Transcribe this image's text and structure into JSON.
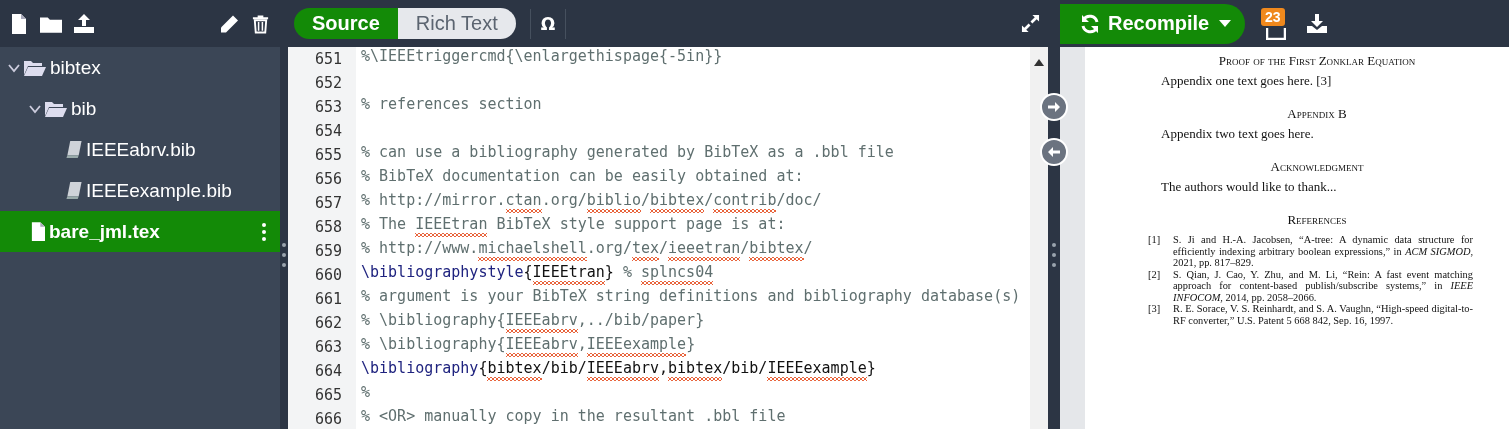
{
  "toolbar": {
    "editor_mode": [
      {
        "label": "Source",
        "selected": true
      },
      {
        "label": "Rich Text",
        "selected": false
      }
    ],
    "symbol_button": "Ω",
    "recompile": "Recompile",
    "log_badge": "23"
  },
  "file_tree": [
    {
      "name": "bibtex",
      "kind": "folder",
      "expanded": true,
      "selected": false,
      "children": [
        {
          "name": "bib",
          "kind": "folder",
          "expanded": true,
          "selected": false,
          "children": [
            {
              "name": "IEEEabrv.bib",
              "kind": "file",
              "selected": false
            },
            {
              "name": "IEEEexample.bib",
              "kind": "file",
              "selected": false
            }
          ]
        }
      ]
    },
    {
      "name": "bare_jml.tex",
      "kind": "file",
      "selected": true
    }
  ],
  "editor": {
    "lines": [
      {
        "number": "651",
        "segments": [
          {
            "text": "%\\IEEEtriggercmd{\\enlargethispage{-5in}}",
            "kind": "comment",
            "misspelled": false
          }
        ]
      },
      {
        "number": "652"
      },
      {
        "number": "653",
        "segments": [
          {
            "text": "% references section",
            "kind": "comment",
            "misspelled": false
          }
        ]
      },
      {
        "number": "654"
      },
      {
        "number": "655",
        "segments": [
          {
            "text": "% can use a bibliography generated by BibTeX as a .bbl file",
            "kind": "comment",
            "misspelled": false
          }
        ]
      },
      {
        "number": "656",
        "segments": [
          {
            "text": "% BibTeX documentation can be easily obtained at:",
            "kind": "comment",
            "misspelled": false
          }
        ]
      },
      {
        "number": "657",
        "segments": [
          {
            "text": "% http://mirror.",
            "kind": "comment",
            "misspelled": false
          },
          {
            "text": "ctan",
            "kind": "comment",
            "misspelled": true
          },
          {
            "text": ".org/",
            "kind": "comment",
            "misspelled": false
          },
          {
            "text": "biblio",
            "kind": "comment",
            "misspelled": true
          },
          {
            "text": "/",
            "kind": "comment",
            "misspelled": false
          },
          {
            "text": "bibtex",
            "kind": "comment",
            "misspelled": true
          },
          {
            "text": "/",
            "kind": "comment",
            "misspelled": false
          },
          {
            "text": "contrib",
            "kind": "comment",
            "misspelled": true
          },
          {
            "text": "/doc/",
            "kind": "comment",
            "misspelled": false
          }
        ]
      },
      {
        "number": "658",
        "segments": [
          {
            "text": "% The ",
            "kind": "comment",
            "misspelled": false
          },
          {
            "text": "IEEEtran",
            "kind": "comment",
            "misspelled": true
          },
          {
            "text": " BibTeX style support page is at:",
            "kind": "comment",
            "misspelled": false
          }
        ]
      },
      {
        "number": "659",
        "segments": [
          {
            "text": "% http://www.",
            "kind": "comment",
            "misspelled": false
          },
          {
            "text": "michaelshell",
            "kind": "comment",
            "misspelled": true
          },
          {
            "text": ".org/",
            "kind": "comment",
            "misspelled": false
          },
          {
            "text": "tex",
            "kind": "comment",
            "misspelled": true
          },
          {
            "text": "/",
            "kind": "comment",
            "misspelled": false
          },
          {
            "text": "ieeetran",
            "kind": "comment",
            "misspelled": true
          },
          {
            "text": "/",
            "kind": "comment",
            "misspelled": false
          },
          {
            "text": "bibtex",
            "kind": "comment",
            "misspelled": true
          },
          {
            "text": "/",
            "kind": "comment",
            "misspelled": false
          }
        ]
      },
      {
        "number": "660",
        "segments": [
          {
            "text": "\\bibliographystyle",
            "kind": "command",
            "misspelled": false
          },
          {
            "text": "{",
            "kind": "plain",
            "misspelled": false
          },
          {
            "text": "IEEEtran",
            "kind": "plain",
            "misspelled": true
          },
          {
            "text": "}",
            "kind": "plain",
            "misspelled": false
          },
          {
            "text": " % ",
            "kind": "comment",
            "misspelled": false
          },
          {
            "text": "splncs04",
            "kind": "comment",
            "misspelled": true
          }
        ]
      },
      {
        "number": "661",
        "segments": [
          {
            "text": "% argument is your BibTeX string definitions and bibliography database(s)",
            "kind": "comment",
            "misspelled": false
          }
        ]
      },
      {
        "number": "662",
        "segments": [
          {
            "text": "% \\bibliography{",
            "kind": "comment",
            "misspelled": false
          },
          {
            "text": "IEEEabrv",
            "kind": "comment",
            "misspelled": true
          },
          {
            "text": ",../bib/paper}",
            "kind": "comment",
            "misspelled": false
          }
        ]
      },
      {
        "number": "663",
        "segments": [
          {
            "text": "% \\bibliography{",
            "kind": "comment",
            "misspelled": false
          },
          {
            "text": "IEEEabrv",
            "kind": "comment",
            "misspelled": true
          },
          {
            "text": ",",
            "kind": "comment",
            "misspelled": false
          },
          {
            "text": "IEEEexample",
            "kind": "comment",
            "misspelled": true
          },
          {
            "text": "}",
            "kind": "comment",
            "misspelled": false
          }
        ]
      },
      {
        "number": "664",
        "segments": [
          {
            "text": "\\bibliography",
            "kind": "command",
            "misspelled": false
          },
          {
            "text": "{",
            "kind": "plain",
            "misspelled": false
          },
          {
            "text": "bibtex",
            "kind": "plain",
            "misspelled": true
          },
          {
            "text": "/bib/",
            "kind": "plain",
            "misspelled": false
          },
          {
            "text": "IEEEabrv",
            "kind": "plain",
            "misspelled": true
          },
          {
            "text": ",",
            "kind": "plain",
            "misspelled": false
          },
          {
            "text": "bibtex",
            "kind": "plain",
            "misspelled": true
          },
          {
            "text": "/bib/",
            "kind": "plain",
            "misspelled": false
          },
          {
            "text": "IEEEexample",
            "kind": "plain",
            "misspelled": true
          },
          {
            "text": "}",
            "kind": "plain",
            "misspelled": false
          }
        ]
      },
      {
        "number": "665",
        "segments": [
          {
            "text": "%",
            "kind": "comment",
            "misspelled": false
          }
        ]
      },
      {
        "number": "666",
        "segments": [
          {
            "text": "% <OR> manually copy in the resultant .bbl file",
            "kind": "comment",
            "misspelled": false
          }
        ]
      }
    ]
  },
  "pdf": {
    "sections": [
      {
        "heading": "Proof of the First Zonklar Equation",
        "text": "Appendix one text goes here. [3]"
      },
      {
        "heading": "Appendix B",
        "text": "Appendix two text goes here."
      },
      {
        "heading": "Acknowledgment",
        "text": "The authors would like to thank..."
      }
    ],
    "references": {
      "heading": "References",
      "items": [
        {
          "label": "[1]",
          "text": "S. Ji and H.-A. Jacobsen, “A-tree: A dynamic data structure for efficiently indexing arbitrary boolean expressions,” in *ACM SIGMOD*, 2021, pp. 817–829."
        },
        {
          "label": "[2]",
          "text": "S. Qian, J. Cao, Y. Zhu, and M. Li, “Rein: A fast event matching approach for content-based publish/subscribe systems,” in *IEEE INFOCOM*, 2014, pp. 2058–2066."
        },
        {
          "label": "[3]",
          "text": "R. E. Sorace, V. S. Reinhardt, and S. A. Vaughn, “High-speed digital-to-RF converter,” U.S. Patent 5 668 842, Sep. 16, 1997."
        }
      ]
    }
  }
}
